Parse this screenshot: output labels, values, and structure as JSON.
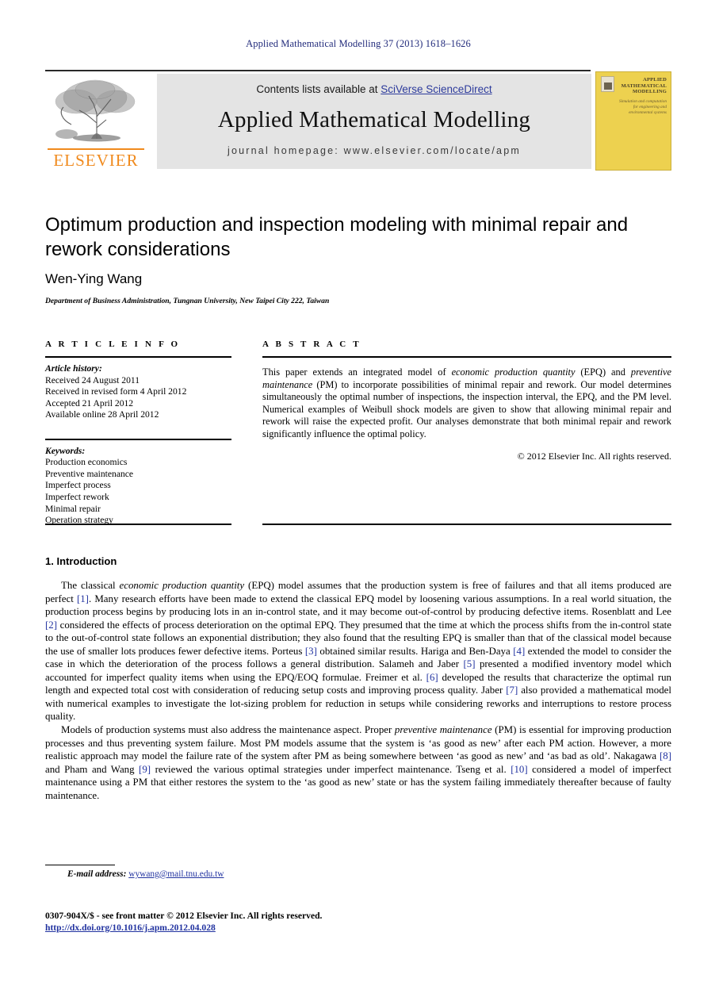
{
  "running_head": "Applied Mathematical Modelling 37 (2013) 1618–1626",
  "masthead": {
    "contents_prefix": "Contents lists available at ",
    "contents_link": "SciVerse ScienceDirect",
    "journal_name": "Applied Mathematical Modelling",
    "homepage": "journal homepage: www.elsevier.com/locate/apm",
    "publisher_wordmark": "ELSEVIER",
    "accent_color": "#f08a1d",
    "link_color": "#2d3b9c",
    "masthead_bg": "#e4e4e4"
  },
  "cover": {
    "title": "APPLIED MATHEMATICAL MODELLING",
    "subtitle": "Simulation and computation for engineering and environmental systems",
    "bg_color": "#edd14f"
  },
  "article": {
    "title": "Optimum production and inspection modeling with minimal repair and rework considerations",
    "author": "Wen-Ying Wang",
    "affiliation": "Department of Business Administration, Tungnan University, New Taipei City 222, Taiwan"
  },
  "info": {
    "heading": "A R T I C L E   I N F O",
    "history_label": "Article history:",
    "history": [
      "Received 24 August 2011",
      "Received in revised form 4 April 2012",
      "Accepted 21 April 2012",
      "Available online 28 April 2012"
    ],
    "keywords_label": "Keywords:",
    "keywords": [
      "Production economics",
      "Preventive maintenance",
      "Imperfect process",
      "Imperfect rework",
      "Minimal repair",
      "Operation strategy"
    ]
  },
  "abstract": {
    "heading": "A B S T R A C T",
    "text_html": "This paper extends an integrated model of <i>economic production quantity</i> (EPQ) and <i>preventive maintenance</i> (PM) to incorporate possibilities of minimal repair and rework. Our model determines simultaneously the optimal number of inspections, the inspection interval, the EPQ, and the PM level. Numerical examples of Weibull shock models are given to show that allowing minimal repair and rework will raise the expected profit. Our analyses demonstrate that both minimal repair and rework significantly influence the optimal policy.",
    "copyright": "© 2012 Elsevier Inc. All rights reserved."
  },
  "body": {
    "section_title": "1. Introduction",
    "paragraph1_html": "The classical <i>economic production quantity</i> (EPQ) model assumes that the production system is free of failures and that all items produced are perfect <span class=\"cite\">[1]</span>. Many research efforts have been made to extend the classical EPQ model by loosening various assumptions. In a real world situation, the production process begins by producing lots in an in-control state, and it may become out-of-control by producing defective items. Rosenblatt and Lee <span class=\"cite\">[2]</span> considered the effects of process deterioration on the optimal EPQ. They presumed that the time at which the process shifts from the in-control state to the out-of-control state follows an exponential distribution; they also found that the resulting EPQ is smaller than that of the classical model because the use of smaller lots produces fewer defective items. Porteus <span class=\"cite\">[3]</span> obtained similar results. Hariga and Ben-Daya <span class=\"cite\">[4]</span> extended the model to consider the case in which the deterioration of the process follows a general distribution. Salameh and Jaber <span class=\"cite\">[5]</span> presented a modified inventory model which accounted for imperfect quality items when using the EPQ/EOQ formulae. Freimer et al. <span class=\"cite\">[6]</span> developed the results that characterize the optimal run length and expected total cost with consideration of reducing setup costs and improving process quality. Jaber <span class=\"cite\">[7]</span> also provided a mathematical model with numerical examples to investigate the lot-sizing problem for reduction in setups while considering reworks and interruptions to restore process quality.",
    "paragraph2_html": "Models of production systems must also address the maintenance aspect. Proper <i>preventive maintenance</i> (PM) is essential for improving production processes and thus preventing system failure. Most PM models assume that the system is ‘as good as new’ after each PM action. However, a more realistic approach may model the failure rate of the system after PM as being somewhere between ‘as good as new’ and ‘as bad as old’. Nakagawa <span class=\"cite\">[8]</span> and Pham and Wang <span class=\"cite\">[9]</span> reviewed the various optimal strategies under imperfect maintenance. Tseng et al. <span class=\"cite\">[10]</span> considered a model of imperfect maintenance using a PM that either restores the system to the ‘as good as new’ state or has the system failing immediately thereafter because of faulty maintenance."
  },
  "footer": {
    "email_label": "E-mail address:",
    "email": "wywang@mail.tnu.edu.tw",
    "imprint": "0307-904X/$ - see front matter © 2012 Elsevier Inc. All rights reserved.",
    "doi": "http://dx.doi.org/10.1016/j.apm.2012.04.028"
  }
}
